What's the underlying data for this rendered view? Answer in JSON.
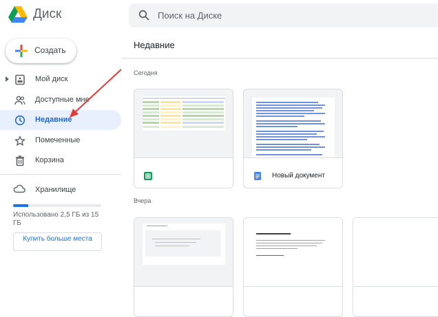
{
  "app": {
    "title": "Диск",
    "logo_icon": "google-drive-icon"
  },
  "search": {
    "placeholder": "Поиск на Диске"
  },
  "create_button": {
    "label": "Создать"
  },
  "nav": [
    {
      "id": "my-drive",
      "label": "Мой диск",
      "icon": "my-drive-icon"
    },
    {
      "id": "shared",
      "label": "Доступные мне",
      "icon": "people-icon"
    },
    {
      "id": "recent",
      "label": "Недавние",
      "icon": "clock-icon",
      "active": true
    },
    {
      "id": "starred",
      "label": "Помеченные",
      "icon": "star-icon"
    },
    {
      "id": "trash",
      "label": "Корзина",
      "icon": "trash-icon"
    }
  ],
  "storage": {
    "label": "Хранилище",
    "used_fraction": 0.17,
    "text": "Использовано 2,5 ГБ из 15 ГБ",
    "buy_label": "Купить больше места"
  },
  "main": {
    "title": "Недавние",
    "sections": [
      {
        "label": "Сегодня"
      },
      {
        "label": "Вчера"
      }
    ],
    "today_files": [
      {
        "name": "",
        "type": "sheets",
        "icon": "google-sheets-icon"
      },
      {
        "name": "Новый документ",
        "type": "docs",
        "icon": "google-docs-icon"
      }
    ],
    "yesterday_files": [
      {
        "type": "docs-preview"
      },
      {
        "type": "docs-preview"
      },
      {
        "type": "blank-preview"
      }
    ]
  },
  "colors": {
    "accent": "#1a73e8",
    "active_bg": "#e8f0fe",
    "sheets": "#0f9d58",
    "docs": "#4285f4",
    "annotation_arrow": "#e53935"
  }
}
